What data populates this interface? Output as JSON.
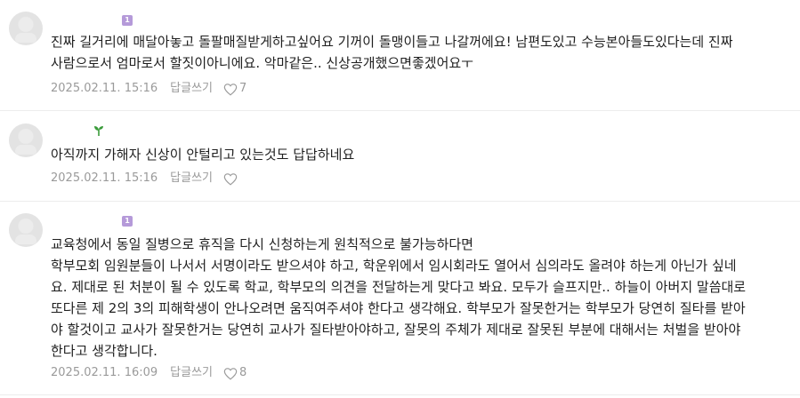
{
  "comments": [
    {
      "text": "진짜 길거리에 매달아놓고 돌팔매질받게하고싶어요 기꺼이 돌맹이들고 나갈꺼에요! 남편도있고 수능본아들도있다는데 진짜\n사람으로서 엄마로서 할짓이아니에요. 악마같은.. 신상공개했으면좋겠어요ㅜ",
      "date": "2025.02.11. 15:16",
      "reply_label": "답글쓰기",
      "likes": "7",
      "badge": "1",
      "badge_color": "#b59ad9"
    },
    {
      "text": "아직까지 가해자 신상이 안털리고 있는것도 답답하네요",
      "date": "2025.02.11. 15:16",
      "reply_label": "답글쓰기",
      "likes": "",
      "badge_icon": "sprout-icon",
      "badge_color": "#3a9b3a"
    },
    {
      "text": "교육청에서 동일 질병으로 휴직을 다시 신청하는게 원칙적으로 불가능하다면\n학부모회 임원분들이 나서서 서명이라도 받으셔야 하고, 학운위에서 임시회라도 열어서 심의라도 올려야 하는게 아닌가 싶네\n요. 제대로 된 처분이 될 수 있도록 학교, 학부모의 의견을 전달하는게 맞다고 봐요. 모두가 슬프지만.. 하늘이 아버지 말씀대로\n또다른 제 2의 3의 피해학생이 안나오려면 움직여주셔야 한다고 생각해요. 학부모가 잘못한거는 학부모가 당연히 질타를 받아\n야 할것이고 교사가 잘못한거는 당연히 교사가 질타받아야하고, 잘못의 주체가 제대로 잘못된 부분에 대해서는 처벌을 받아야\n한다고 생각합니다.",
      "date": "2025.02.11. 16:09",
      "reply_label": "답글쓰기",
      "likes": "8",
      "badge": "1",
      "badge_color": "#b59ad9"
    }
  ]
}
